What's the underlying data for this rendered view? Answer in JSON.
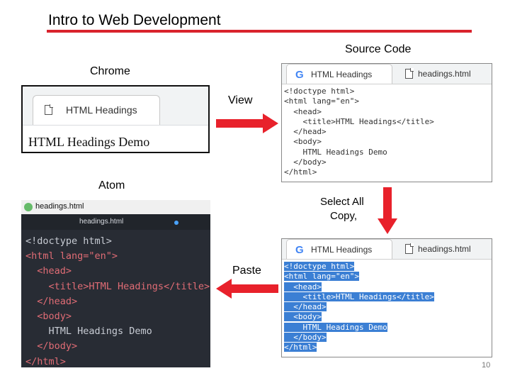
{
  "slide": {
    "title": "Intro to Web Development",
    "page_number": "10",
    "accent_color": "#d9232d"
  },
  "labels": {
    "source_code": "Source Code",
    "chrome": "Chrome",
    "view": "View",
    "atom": "Atom",
    "select_all": "Select  All",
    "copy": "Copy,",
    "paste": "Paste"
  },
  "chrome_window": {
    "tab_title": "HTML Headings",
    "page_heading": "HTML Headings Demo"
  },
  "source_top": {
    "tab_title": "HTML Headings",
    "tab2_title": "headings.html",
    "code_lines": [
      "<!doctype html>",
      "<html lang=\"en\">",
      "  <head>",
      "    <title>HTML Headings</title>",
      "  </head>",
      "  <body>",
      "    HTML Headings Demo",
      "  </body>",
      "</html>"
    ]
  },
  "source_bottom": {
    "tab_title": "HTML Headings",
    "tab2_title": "headings.html",
    "selected": true,
    "code_lines": [
      "<!doctype html>",
      "<html lang=\"en\">",
      "  <head>",
      "    <title>HTML Headings</title>",
      "  </head>",
      "  <body>",
      "    HTML Headings Demo",
      "  </body>",
      "</html>"
    ]
  },
  "atom_editor": {
    "window_title": "headings.html",
    "tab_title": "headings.html",
    "code_lines": [
      "<!doctype html>",
      "<html lang=\"en\">",
      "  <head>",
      "    <title>HTML Headings</title>",
      "  </head>",
      "  <body>",
      "    HTML Headings Demo",
      "  </body>",
      "</html>"
    ]
  },
  "icons": {
    "google": "google-g-icon",
    "document": "document-icon",
    "atom": "atom-logo-icon",
    "unsaved": "modified-dot-icon"
  },
  "arrow_color": "#e8212b"
}
